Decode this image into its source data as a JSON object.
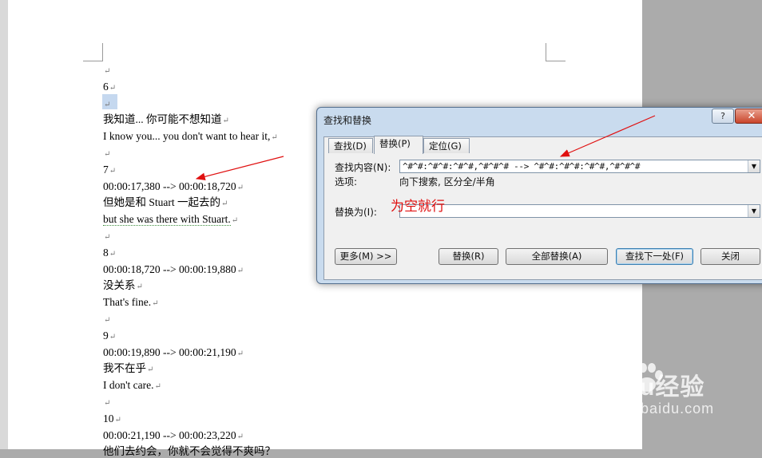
{
  "document": {
    "lines": [
      "",
      "6",
      "",
      "我知道... 你可能不想知道",
      "I know you... you don't want to hear it,",
      "",
      "7",
      "00:00:17,380 --> 00:00:18,720",
      "但她是和 Stuart 一起去的",
      "but she was there with Stuart.",
      "",
      "8",
      "00:00:18,720 --> 00:00:19,880",
      "没关系",
      "That's fine.",
      "",
      "9",
      "00:00:19,890 --> 00:00:21,190",
      "我不在乎",
      "I don't care.",
      "",
      "10",
      "00:00:21,190 --> 00:00:23,220",
      "他们去约会，你就不会觉得不爽吗？"
    ],
    "paragraph_mark": "↵"
  },
  "dialog": {
    "title": "查找和替换",
    "help_label": "?",
    "close_label": "✕",
    "tabs": [
      {
        "label": "查找(D)",
        "active": false
      },
      {
        "label": "替换(P)",
        "active": true
      },
      {
        "label": "定位(G)",
        "active": false
      }
    ],
    "find_label": "查找内容(N):",
    "find_value": "^#^#:^#^#:^#^#,^#^#^# --> ^#^#:^#^#:^#^#,^#^#^#",
    "options_label": "选项:",
    "options_value": "向下搜索, 区分全/半角",
    "replace_label": "替换为(I):",
    "replace_value": "",
    "buttons": {
      "more": "更多(M) >>",
      "replace": "替换(R)",
      "replace_all": "全部替换(A)",
      "find_next": "查找下一处(F)",
      "close": "关闭"
    }
  },
  "annotation": {
    "text": "为空就行",
    "color": "#e01010"
  },
  "watermark": {
    "main": "Baidu经验",
    "sub": "jingyan.baidu.com"
  }
}
